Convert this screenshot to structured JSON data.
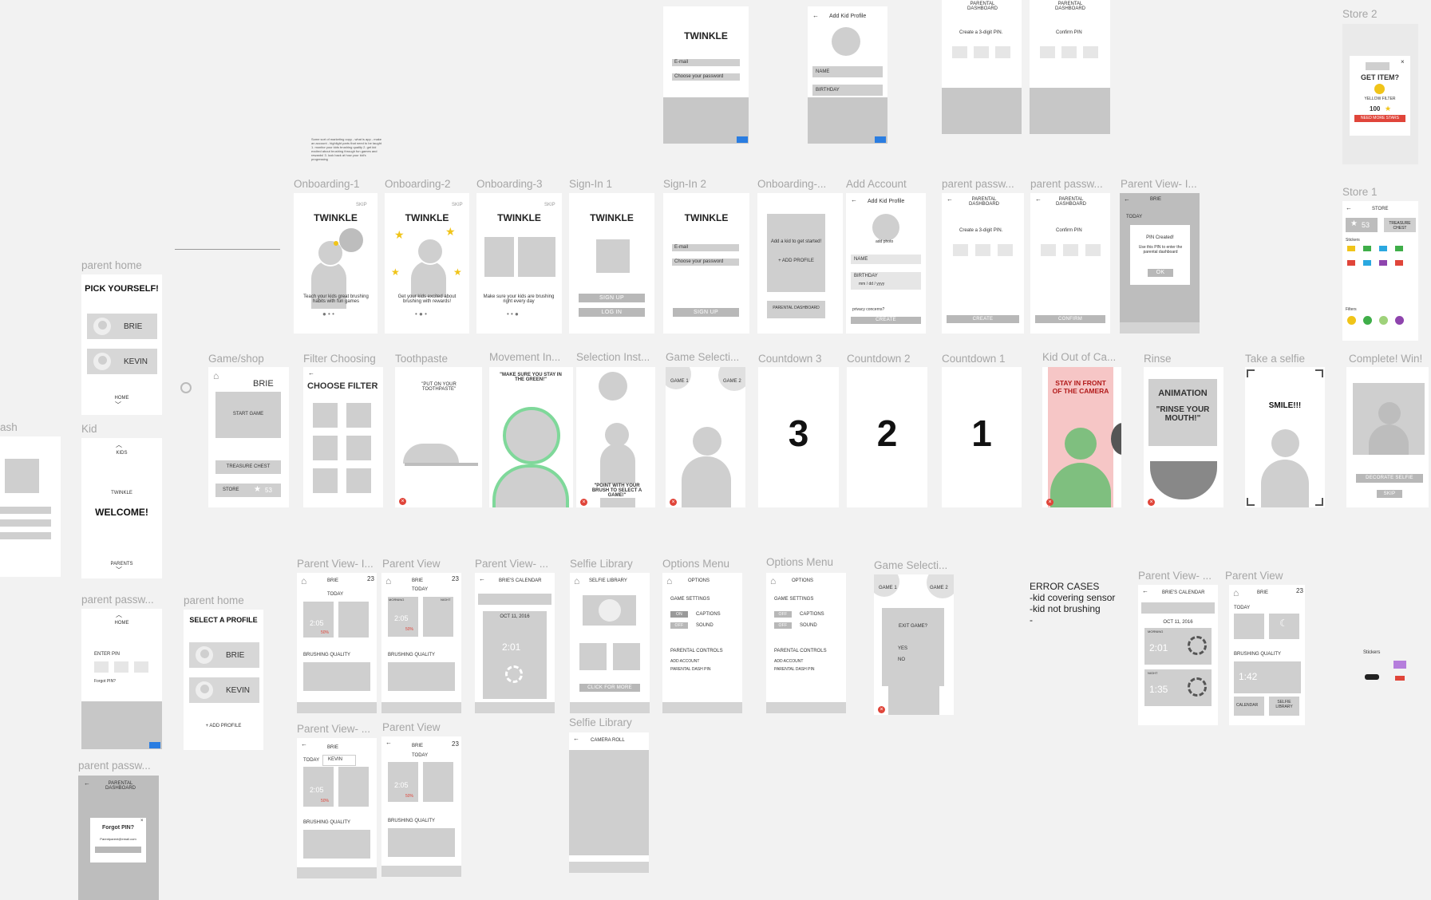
{
  "labels": {
    "onb1": "Onboarding-1",
    "onb2": "Onboarding-2",
    "onb3": "Onboarding-3",
    "signin1": "Sign-In 1",
    "signin2": "Sign-In 2",
    "onbdots": "Onboarding-...",
    "addacct": "Add Account",
    "pp1": "parent passw...",
    "pp2": "parent passw...",
    "pv1": "Parent View- I...",
    "store2": "Store 2",
    "store1": "Store 1",
    "parenthome": "parent home",
    "kid": "Kid",
    "ash": "ash",
    "parentpass_left": "parent passw...",
    "parentpass_left2": "parent passw...",
    "parenthome2": "parent home",
    "gameshop": "Game/shop",
    "filter": "Filter Choosing",
    "toothpaste": "Toothpaste",
    "movement": "Movement In...",
    "selinst": "Selection Inst...",
    "gamesel": "Game Selecti...",
    "cd3": "Countdown 3",
    "cd2": "Countdown 2",
    "cd1": "Countdown 1",
    "kidout": "Kid Out of Ca...",
    "rinse": "Rinse",
    "selfie": "Take a selfie",
    "complete": "Complete! Win!",
    "pvI1": "Parent View- I...",
    "pv": "Parent View",
    "pvdots": "Parent View- ...",
    "selfielib": "Selfie Library",
    "opt1": "Options Menu",
    "opt2": "Options Menu",
    "gamesel2": "Game Selecti...",
    "pvr1": "Parent View- ...",
    "pvr2": "Parent View",
    "pvb1": "Parent View- ...",
    "pvb2": "Parent View",
    "selfielib2": "Selfie Library"
  },
  "text": {
    "twinkle": "TWINKLE",
    "skip": "SKIP",
    "teach": "Teach your kids great brushing habits with fun games",
    "excited": "Get your kids excited about brushing with rewards!",
    "brushing_every": "Make sure your kids are brushing right every day",
    "signup": "SIGN UP",
    "login": "LOG IN",
    "email": "E-mail",
    "password": "Choose your password",
    "terms": "By signing up I agree with Twinkle's Terms of Use and Privacy Policy",
    "addkid": "Add a kid to get started!",
    "addprofile": "+ ADD PROFILE",
    "parentdash": "PARENTAL DASHBOARD",
    "addkidprofile": "Add Kid Profile",
    "addphoto": "add photo",
    "name": "NAME",
    "birthday": "BIRTHDAY",
    "mmddyyyy": "mm / dd / yyyy",
    "privacy": "privacy concerns?",
    "create": "CREATE",
    "parental_dashboard": "PARENTAL DASHBOARD",
    "create3pin": "Create a 3-digit PIN.",
    "confirmpin": "Confirm PIN",
    "confirm": "CONFIRM",
    "pincreated": "PIN Created!",
    "pinuse": "Use this PIN to enter the parental dashboard",
    "ok": "OK",
    "today": "TODAY",
    "brie": "BRIE",
    "kevin": "KEVIN",
    "pick": "PICK YOURSELF!",
    "home": "HOME",
    "kids": "KIDS",
    "welcome": "WELCOME!",
    "parents": "PARENTS",
    "enterpin": "ENTER PIN",
    "forgotpin": "Forgot PIN?",
    "forgotq": "Forgot PIN?",
    "parentemail": "Parentparent@email.com",
    "selectprofile": "SELECT A PROFILE",
    "startgame": "START GAME",
    "treasure": "TREASURE CHEST",
    "store": "STORE",
    "stars": "53",
    "choosefilter": "CHOOSE FILTER",
    "putpaste": "\"PUT ON YOUR TOOTHPASTE\"",
    "stayin": "\"MAKE SURE YOU STAY IN THE GREEN!\"",
    "point": "\"POINT WITH YOUR BRUSH TO SELECT A GAME!\"",
    "game1": "GAME 1",
    "game2": "GAME 2",
    "n3": "3",
    "n2": "2",
    "n1": "1",
    "stayfront": "STAY IN FRONT OF THE CAMERA",
    "animation": "ANIMATION",
    "rinsemouth": "\"RINSE YOUR MOUTH!\"",
    "smile": "SMILE!!!",
    "decorate": "DECORATE SELFIE",
    "skipbtn": "SKIP",
    "getitem": "GET ITEM?",
    "yellowfilter": "YELLOW FILTER",
    "price": "100",
    "needmore": "NEED MORE STARS",
    "storehdr": "STORE",
    "treasure_sm": "TREASURE CHEST",
    "stickers": "Stickers",
    "filters": "Filters",
    "brushq": "BRUSHING QUALITY",
    "time1": "2:05",
    "pct": "50%",
    "morning": "MORNING",
    "night": "NIGHT",
    "calendar": "BRIE'S CALENDAR",
    "date": "OCT 11, 2016",
    "t201": "2:01",
    "t135": "1:35",
    "t142": "1:42",
    "selfielibhdr": "SELFIE LIBRARY",
    "clickmore": "CLICK FOR MORE",
    "cameraroll": "CAMERA ROLL",
    "options": "OPTIONS",
    "gamesettings": "GAME SETTINGS",
    "on": "ON",
    "off": "OFF",
    "captions": "CAPTIONS",
    "sound": "SOUND",
    "parentalcontrols": "PARENTAL CONTROLS",
    "addaccount": "ADD ACCOUNT",
    "parentdashpin": "PARENTAL DASH PIN",
    "exitgame": "EXIT GAME?",
    "yes": "YES",
    "no": "NO",
    "err_title": "ERROR CASES",
    "err1": "-kid covering sensor",
    "err2": "-kid not brushing",
    "err3": "-",
    "calendar_btn": "CALENDAR",
    "selfielib_btn": "SELFIE LIBRARY",
    "notes": "Some sort of marketing copy - what is app - make an account - highlight parts that need to be taught 1. monitor your kids brushing quality 2. get kid excited about brushing through fun games and rewards! 3. look back at how your kid's progressing",
    "day23": "23",
    "stickers_lbl": "Stickers"
  }
}
